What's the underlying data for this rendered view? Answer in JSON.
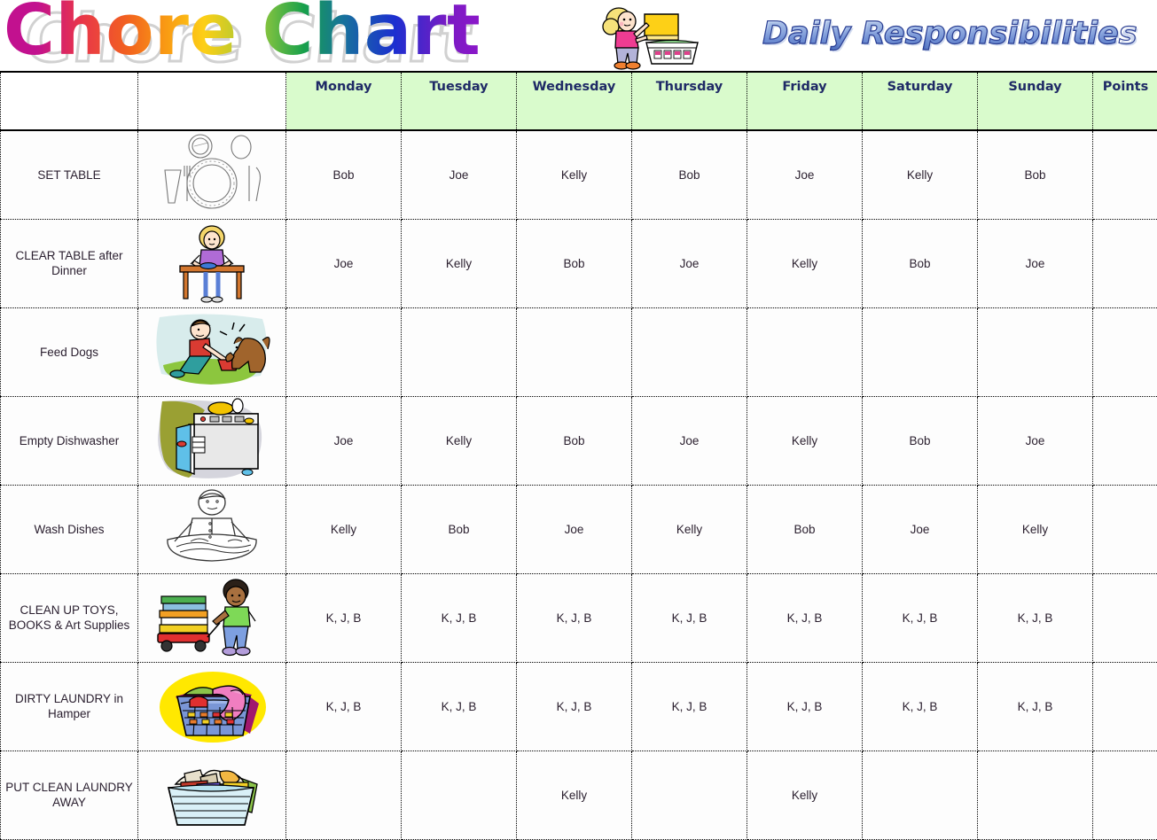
{
  "banner": {
    "title": "Chore Chart",
    "subtitle": "Daily Responsibilities",
    "clipart_name": "girl-folding-laundry-clipart",
    "title_colors": [
      "#c2118f",
      "#e8344b",
      "#f2621f",
      "#f99a13",
      "#fdcf16",
      "#8fc73e",
      "#17a04b",
      "#17739b",
      "#1c2fd0",
      "#7a1bc4"
    ],
    "subtitle_color": "#2e4fa8"
  },
  "colors": {
    "header_background": "#d9fbcc",
    "header_text": "#1f2a66",
    "cell_text": "#2a1f2e",
    "grid_line": "#000000",
    "page_background": "#ffffff"
  },
  "chart_data": {
    "type": "table",
    "title": "Chore Chart",
    "subtitle": "Daily Responsibilities",
    "columns": [
      "",
      "",
      "Monday",
      "Tuesday",
      "Wednesday",
      "Thursday",
      "Friday",
      "Saturday",
      "Sunday",
      "Points"
    ],
    "day_columns": [
      "Monday",
      "Tuesday",
      "Wednesday",
      "Thursday",
      "Friday",
      "Saturday",
      "Sunday"
    ],
    "points_column": "Points",
    "rows": [
      {
        "chore": "SET TABLE",
        "icon": "place-setting-clipart",
        "assignments": [
          "Bob",
          "Joe",
          "Kelly",
          "Bob",
          "Joe",
          "Kelly",
          "Bob"
        ],
        "points": ""
      },
      {
        "chore": "CLEAR TABLE after Dinner",
        "icon": "girl-at-table-clipart",
        "assignments": [
          "Joe",
          "Kelly",
          "Bob",
          "Joe",
          "Kelly",
          "Bob",
          "Joe"
        ],
        "points": ""
      },
      {
        "chore": "Feed Dogs",
        "icon": "boy-feeding-dog-clipart",
        "assignments": [
          "",
          "",
          "",
          "",
          "",
          "",
          ""
        ],
        "points": ""
      },
      {
        "chore": "Empty Dishwasher",
        "icon": "dishwasher-clipart",
        "assignments": [
          "Joe",
          "Kelly",
          "Bob",
          "Joe",
          "Kelly",
          "Bob",
          "Joe"
        ],
        "points": ""
      },
      {
        "chore": "Wash Dishes",
        "icon": "person-washing-dishes-clipart",
        "assignments": [
          "Kelly",
          "Bob",
          "Joe",
          "Kelly",
          "Bob",
          "Joe",
          "Kelly"
        ],
        "points": ""
      },
      {
        "chore": "CLEAN UP TOYS, BOOKS & Art Supplies",
        "icon": "boy-with-wagon-of-books-clipart",
        "assignments": [
          "K, J, B",
          "K, J, B",
          "K, J, B",
          "K, J, B",
          "K, J, B",
          "K, J, B",
          "K, J, B"
        ],
        "points": ""
      },
      {
        "chore": "DIRTY LAUNDRY in Hamper",
        "icon": "laundry-basket-dirty-clipart",
        "assignments": [
          "K, J, B",
          "K, J, B",
          "K, J, B",
          "K, J, B",
          "K, J, B",
          "K, J, B",
          "K, J, B"
        ],
        "points": ""
      },
      {
        "chore": "PUT CLEAN LAUNDRY AWAY",
        "icon": "folded-clean-laundry-basket-clipart",
        "assignments": [
          "",
          "",
          "Kelly",
          "",
          "Kelly",
          "",
          ""
        ],
        "points": ""
      }
    ]
  }
}
